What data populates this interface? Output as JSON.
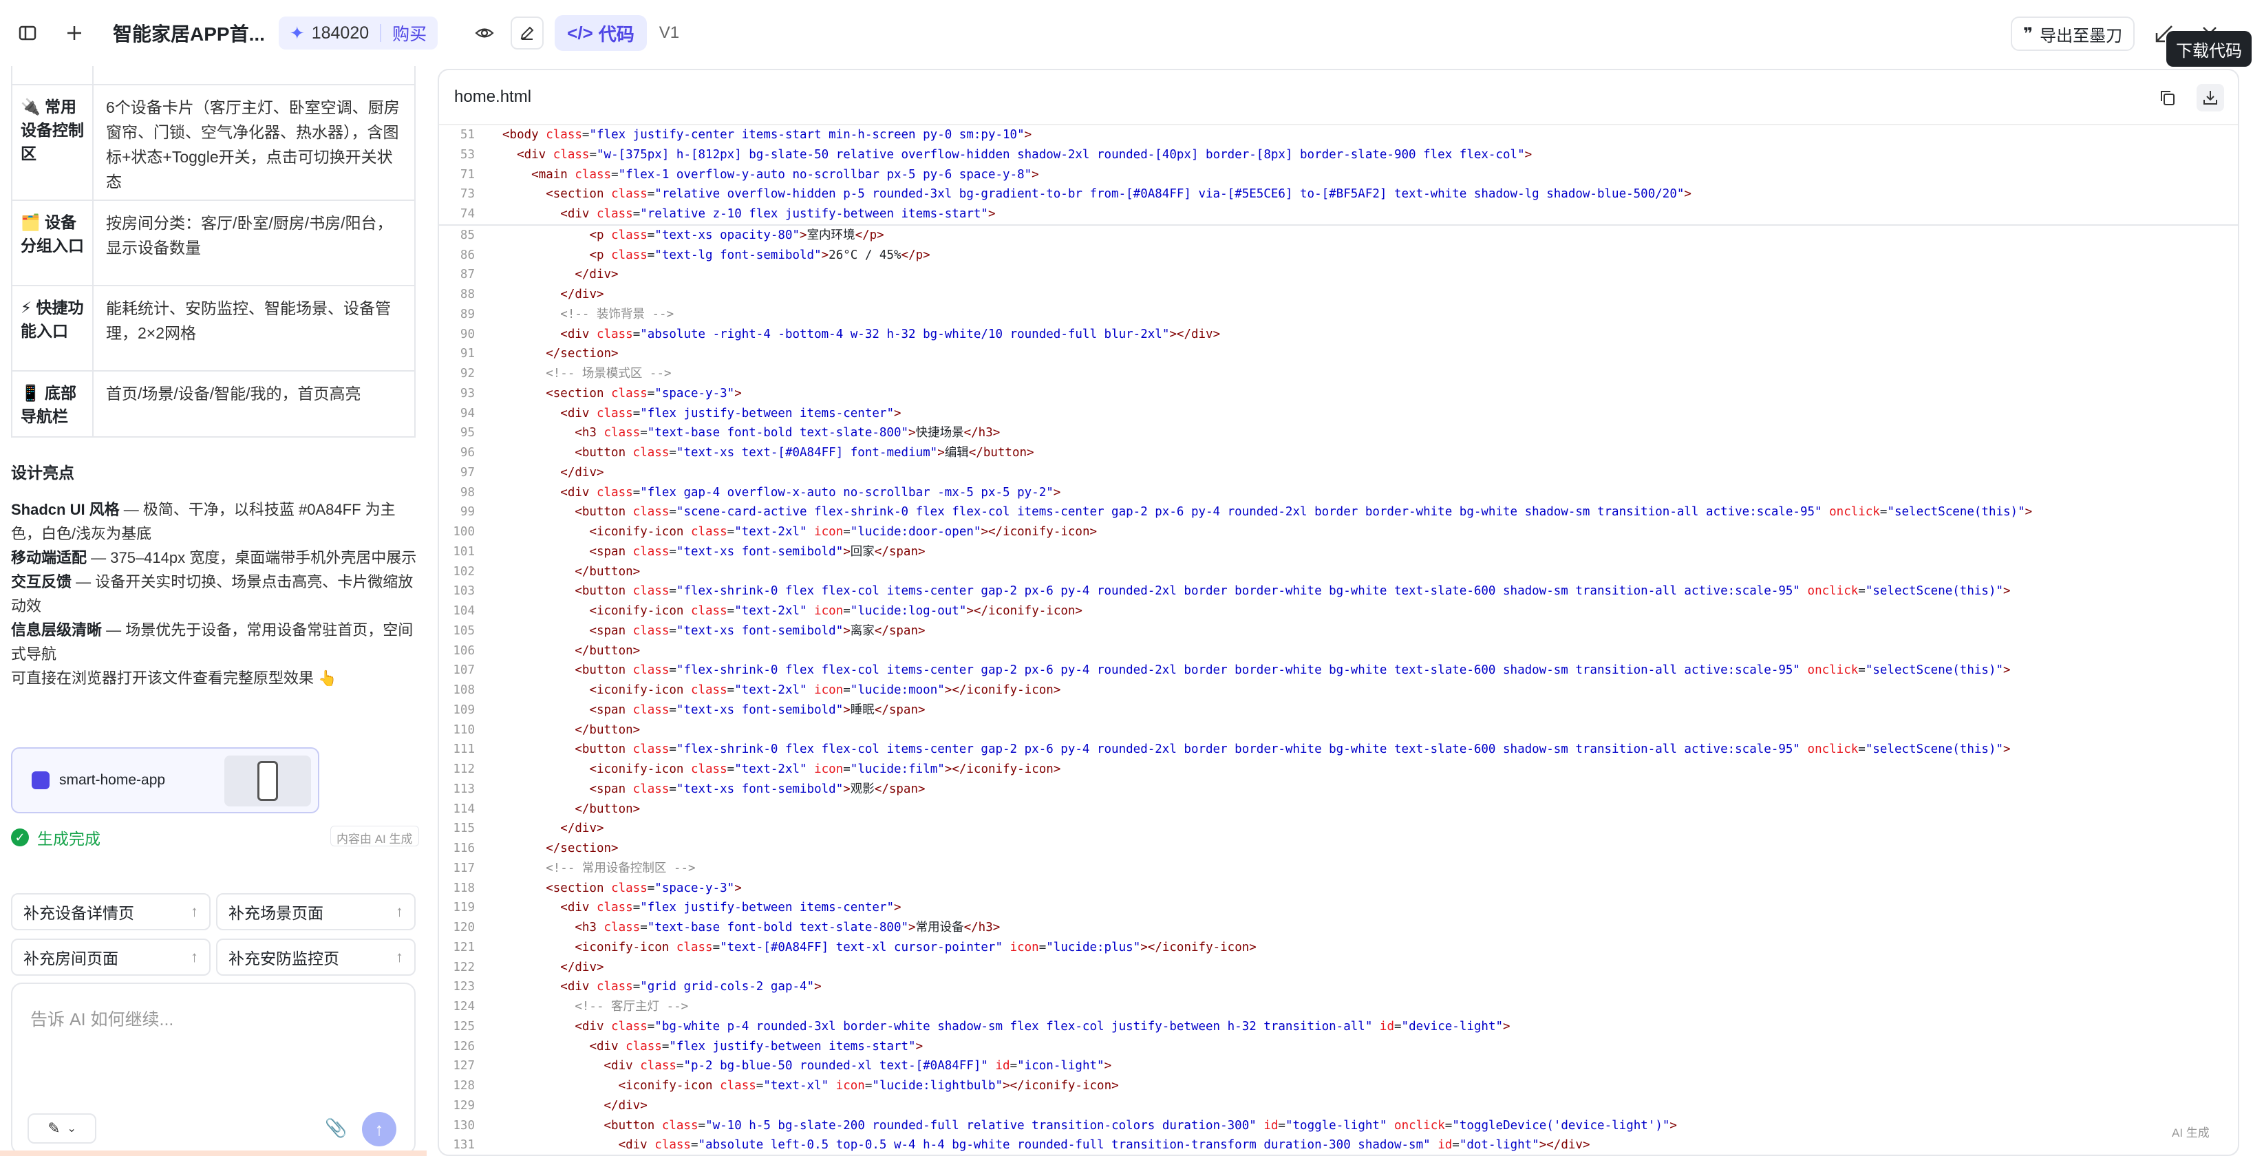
{
  "topbar": {
    "title": "智能家居APP首...",
    "credits": "184020",
    "buy": "购买",
    "code_tab": "代码",
    "version": "V1",
    "export": "导出至墨刀",
    "tooltip": "下载代码"
  },
  "table_rows": [
    {
      "label": "🔌 常用设备控制区",
      "desc": "6个设备卡片（客厅主灯、卧室空调、厨房窗帘、门锁、空气净化器、热水器），含图标+状态+Toggle开关，点击可切换开关状态"
    },
    {
      "label": "🗂️ 设备分组入口",
      "desc": "按房间分类：客厅/卧室/厨房/书房/阳台，显示设备数量"
    },
    {
      "label": "⚡ 快捷功能入口",
      "desc": "能耗统计、安防监控、智能场景、设备管理，2×2网格"
    },
    {
      "label": "📱 底部导航栏",
      "desc": "首页/场景/设备/智能/我的，首页高亮"
    }
  ],
  "highlights": {
    "heading": "设计亮点",
    "items": [
      {
        "title": "Shadcn UI 风格",
        "text": " — 极简、干净，以科技蓝 #0A84FF 为主色，白色/浅灰为基底"
      },
      {
        "title": "移动端适配",
        "text": " — 375–414px 宽度，桌面端带手机外壳居中展示"
      },
      {
        "title": "交互反馈",
        "text": " — 设备开关实时切换、场景点击高亮、卡片微缩放动效"
      },
      {
        "title": "信息层级清晰",
        "text": " — 场景优先于设备，常用设备常驻首页，空间式导航"
      }
    ],
    "footer": "可直接在浏览器打开该文件查看完整原型效果 👆"
  },
  "artifact": {
    "name": "smart-home-app"
  },
  "status": {
    "done": "生成完成",
    "ai_label": "内容由 AI 生成"
  },
  "suggestions": [
    "补充设备详情页",
    "补充场景页面",
    "补充房间页面",
    "补充安防监控页"
  ],
  "input": {
    "placeholder": "告诉 AI 如何继续..."
  },
  "file": {
    "name": "home.html"
  },
  "ai_label_right": "AI 生成",
  "sticky_lines": [
    {
      "n": "51",
      "indent": 0,
      "tag": "body",
      "attrs": [
        [
          "class",
          "flex justify-center items-start min-h-screen py-0 sm:py-10"
        ]
      ],
      "close": false
    },
    {
      "n": "53",
      "indent": 1,
      "tag": "div",
      "attrs": [
        [
          "class",
          "w-[375px] h-[812px] bg-slate-50 relative overflow-hidden shadow-2xl rounded-[40px] border-[8px] border-slate-900 flex flex-col"
        ]
      ],
      "close": false
    },
    {
      "n": "71",
      "indent": 2,
      "tag": "main",
      "attrs": [
        [
          "class",
          "flex-1 overflow-y-auto no-scrollbar px-5 py-6 space-y-8"
        ]
      ],
      "close": false
    },
    {
      "n": "73",
      "indent": 3,
      "tag": "section",
      "attrs": [
        [
          "class",
          "relative overflow-hidden p-5 rounded-3xl bg-gradient-to-br from-[#0A84FF] via-[#5E5CE6] to-[#BF5AF2] text-white shadow-lg shadow-blue-500/20"
        ]
      ],
      "close": false
    },
    {
      "n": "74",
      "indent": 4,
      "tag": "div",
      "attrs": [
        [
          "class",
          "relative z-10 flex justify-between items-start"
        ]
      ],
      "close": false
    }
  ],
  "code_lines": [
    {
      "n": "85",
      "indent": 6,
      "tag": "p",
      "attrs": [
        [
          "class",
          "text-xs opacity-80"
        ]
      ],
      "text": "室内环境",
      "close": true
    },
    {
      "n": "86",
      "indent": 6,
      "tag": "p",
      "attrs": [
        [
          "class",
          "text-lg font-semibold"
        ]
      ],
      "text": "26°C / 45%",
      "close": true
    },
    {
      "n": "87",
      "indent": 5,
      "end": "div"
    },
    {
      "n": "88",
      "indent": 4,
      "end": "div"
    },
    {
      "n": "89",
      "indent": 4,
      "comment": "装饰背景"
    },
    {
      "n": "90",
      "indent": 4,
      "tag": "div",
      "attrs": [
        [
          "class",
          "absolute -right-4 -bottom-4 w-32 h-32 bg-white/10 rounded-full blur-2xl"
        ]
      ],
      "text": "",
      "close": true
    },
    {
      "n": "91",
      "indent": 3,
      "end": "section"
    },
    {
      "n": "92",
      "indent": 3,
      "comment": "场景模式区"
    },
    {
      "n": "93",
      "indent": 3,
      "tag": "section",
      "attrs": [
        [
          "class",
          "space-y-3"
        ]
      ]
    },
    {
      "n": "94",
      "indent": 4,
      "tag": "div",
      "attrs": [
        [
          "class",
          "flex justify-between items-center"
        ]
      ]
    },
    {
      "n": "95",
      "indent": 5,
      "tag": "h3",
      "attrs": [
        [
          "class",
          "text-base font-bold text-slate-800"
        ]
      ],
      "text": "快捷场景",
      "close": true
    },
    {
      "n": "96",
      "indent": 5,
      "tag": "button",
      "attrs": [
        [
          "class",
          "text-xs text-[#0A84FF] font-medium"
        ]
      ],
      "text": "编辑",
      "close": true
    },
    {
      "n": "97",
      "indent": 4,
      "end": "div"
    },
    {
      "n": "98",
      "indent": 4,
      "tag": "div",
      "attrs": [
        [
          "class",
          "flex gap-4 overflow-x-auto no-scrollbar -mx-5 px-5 py-2"
        ]
      ]
    },
    {
      "n": "99",
      "indent": 5,
      "tag": "button",
      "attrs": [
        [
          "class",
          "scene-card-active flex-shrink-0 flex flex-col items-center gap-2 px-6 py-4 rounded-2xl border border-white bg-white shadow-sm transition-all active:scale-95"
        ],
        [
          "onclick",
          "selectScene(this)"
        ]
      ]
    },
    {
      "n": "100",
      "indent": 6,
      "tag": "iconify-icon",
      "attrs": [
        [
          "class",
          "text-2xl"
        ],
        [
          "icon",
          "lucide:door-open"
        ]
      ],
      "text": "",
      "close": true
    },
    {
      "n": "101",
      "indent": 6,
      "tag": "span",
      "attrs": [
        [
          "class",
          "text-xs font-semibold"
        ]
      ],
      "text": "回家",
      "close": true
    },
    {
      "n": "102",
      "indent": 5,
      "end": "button"
    },
    {
      "n": "103",
      "indent": 5,
      "tag": "button",
      "attrs": [
        [
          "class",
          "flex-shrink-0 flex flex-col items-center gap-2 px-6 py-4 rounded-2xl border border-white bg-white text-slate-600 shadow-sm transition-all active:scale-95"
        ],
        [
          "onclick",
          "selectScene(this)"
        ]
      ]
    },
    {
      "n": "104",
      "indent": 6,
      "tag": "iconify-icon",
      "attrs": [
        [
          "class",
          "text-2xl"
        ],
        [
          "icon",
          "lucide:log-out"
        ]
      ],
      "text": "",
      "close": true
    },
    {
      "n": "105",
      "indent": 6,
      "tag": "span",
      "attrs": [
        [
          "class",
          "text-xs font-semibold"
        ]
      ],
      "text": "离家",
      "close": true
    },
    {
      "n": "106",
      "indent": 5,
      "end": "button"
    },
    {
      "n": "107",
      "indent": 5,
      "tag": "button",
      "attrs": [
        [
          "class",
          "flex-shrink-0 flex flex-col items-center gap-2 px-6 py-4 rounded-2xl border border-white bg-white text-slate-600 shadow-sm transition-all active:scale-95"
        ],
        [
          "onclick",
          "selectScene(this)"
        ]
      ]
    },
    {
      "n": "108",
      "indent": 6,
      "tag": "iconify-icon",
      "attrs": [
        [
          "class",
          "text-2xl"
        ],
        [
          "icon",
          "lucide:moon"
        ]
      ],
      "text": "",
      "close": true
    },
    {
      "n": "109",
      "indent": 6,
      "tag": "span",
      "attrs": [
        [
          "class",
          "text-xs font-semibold"
        ]
      ],
      "text": "睡眠",
      "close": true
    },
    {
      "n": "110",
      "indent": 5,
      "end": "button"
    },
    {
      "n": "111",
      "indent": 5,
      "tag": "button",
      "attrs": [
        [
          "class",
          "flex-shrink-0 flex flex-col items-center gap-2 px-6 py-4 rounded-2xl border border-white bg-white text-slate-600 shadow-sm transition-all active:scale-95"
        ],
        [
          "onclick",
          "selectScene(this)"
        ]
      ]
    },
    {
      "n": "112",
      "indent": 6,
      "tag": "iconify-icon",
      "attrs": [
        [
          "class",
          "text-2xl"
        ],
        [
          "icon",
          "lucide:film"
        ]
      ],
      "text": "",
      "close": true
    },
    {
      "n": "113",
      "indent": 6,
      "tag": "span",
      "attrs": [
        [
          "class",
          "text-xs font-semibold"
        ]
      ],
      "text": "观影",
      "close": true
    },
    {
      "n": "114",
      "indent": 5,
      "end": "button"
    },
    {
      "n": "115",
      "indent": 4,
      "end": "div"
    },
    {
      "n": "116",
      "indent": 3,
      "end": "section"
    },
    {
      "n": "117",
      "indent": 3,
      "comment": "常用设备控制区"
    },
    {
      "n": "118",
      "indent": 3,
      "tag": "section",
      "attrs": [
        [
          "class",
          "space-y-3"
        ]
      ]
    },
    {
      "n": "119",
      "indent": 4,
      "tag": "div",
      "attrs": [
        [
          "class",
          "flex justify-between items-center"
        ]
      ]
    },
    {
      "n": "120",
      "indent": 5,
      "tag": "h3",
      "attrs": [
        [
          "class",
          "text-base font-bold text-slate-800"
        ]
      ],
      "text": "常用设备",
      "close": true
    },
    {
      "n": "121",
      "indent": 5,
      "tag": "iconify-icon",
      "attrs": [
        [
          "class",
          "text-[#0A84FF] text-xl cursor-pointer"
        ],
        [
          "icon",
          "lucide:plus"
        ]
      ],
      "text": "",
      "close": true
    },
    {
      "n": "122",
      "indent": 4,
      "end": "div"
    },
    {
      "n": "123",
      "indent": 4,
      "tag": "div",
      "attrs": [
        [
          "class",
          "grid grid-cols-2 gap-4"
        ]
      ]
    },
    {
      "n": "124",
      "indent": 5,
      "comment": "客厅主灯"
    },
    {
      "n": "125",
      "indent": 5,
      "tag": "div",
      "attrs": [
        [
          "class",
          "bg-white p-4 rounded-3xl border-white shadow-sm flex flex-col justify-between h-32 transition-all"
        ],
        [
          "id",
          "device-light"
        ]
      ]
    },
    {
      "n": "126",
      "indent": 6,
      "tag": "div",
      "attrs": [
        [
          "class",
          "flex justify-between items-start"
        ]
      ]
    },
    {
      "n": "127",
      "indent": 7,
      "tag": "div",
      "attrs": [
        [
          "class",
          "p-2 bg-blue-50 rounded-xl text-[#0A84FF]"
        ],
        [
          "id",
          "icon-light"
        ]
      ]
    },
    {
      "n": "128",
      "indent": 8,
      "tag": "iconify-icon",
      "attrs": [
        [
          "class",
          "text-xl"
        ],
        [
          "icon",
          "lucide:lightbulb"
        ]
      ],
      "text": "",
      "close": true
    },
    {
      "n": "129",
      "indent": 7,
      "end": "div"
    },
    {
      "n": "130",
      "indent": 7,
      "tag": "button",
      "attrs": [
        [
          "class",
          "w-10 h-5 bg-slate-200 rounded-full relative transition-colors duration-300"
        ],
        [
          "id",
          "toggle-light"
        ],
        [
          "onclick",
          "toggleDevice('device-light')"
        ]
      ]
    },
    {
      "n": "131",
      "indent": 8,
      "tag": "div",
      "attrs": [
        [
          "class",
          "absolute left-0.5 top-0.5 w-4 h-4 bg-white rounded-full transition-transform duration-300 shadow-sm"
        ],
        [
          "id",
          "dot-light"
        ]
      ],
      "text": "",
      "close": true
    }
  ]
}
